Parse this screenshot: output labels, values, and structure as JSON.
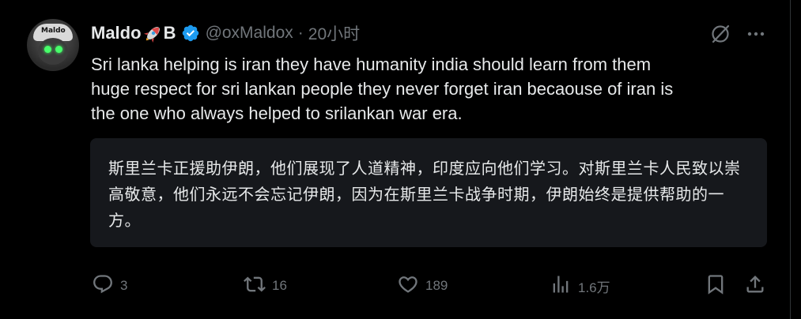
{
  "tweet": {
    "author": {
      "name": "Maldo",
      "name_suffix": "B",
      "handle": "@oxMaldox",
      "separator": "·",
      "time": "20小时",
      "avatar_text": "Maldo",
      "verified": true
    },
    "text": "Sri lanka helping is iran they have humanity india  should learn from them\nhuge respect for sri lankan people they never forget iran becaouse of iran is\nthe one who always helped to srilankan war era.",
    "translation": "斯里兰卡正援助伊朗，他们展现了人道精神，印度应向他们学习。对斯里兰卡人民致以崇高敬意，他们永远不会忘记伊朗，因为在斯里兰卡战争时期，伊朗始终是提供帮助的一方。",
    "actions": {
      "reply_count": "3",
      "repost_count": "16",
      "like_count": "189",
      "view_count": "1.6万"
    }
  },
  "icons": {
    "reply": "reply-icon",
    "repost": "repost-icon",
    "like": "heart-icon",
    "views": "views-chart-icon",
    "bookmark": "bookmark-icon",
    "share": "share-icon",
    "grok": "grok-icon",
    "more": "more-icon",
    "verified": "verified-badge-icon",
    "rocket": "rocket-emoji-icon"
  },
  "colors": {
    "background": "#000000",
    "text": "#e7e9ea",
    "muted": "#71767b",
    "verified_blue": "#1d9bf0",
    "translation_bg": "#16181c"
  }
}
